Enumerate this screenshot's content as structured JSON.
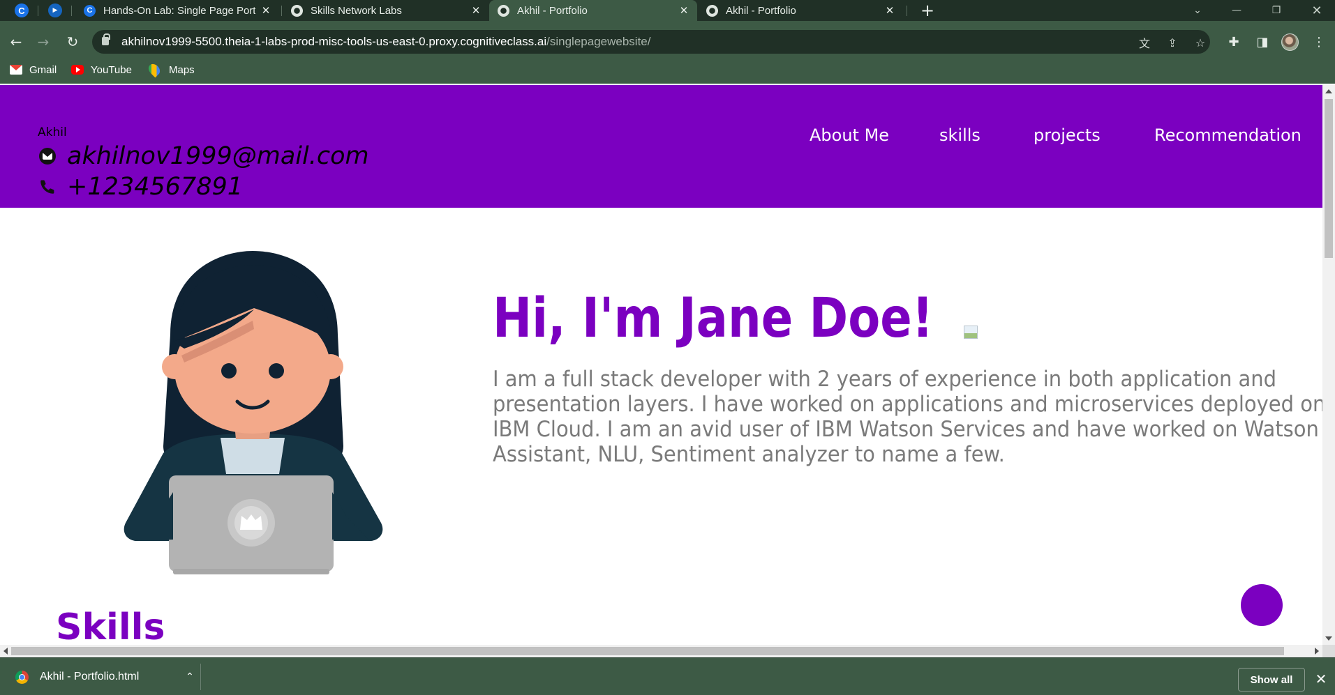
{
  "browser": {
    "tabs": [
      {
        "title": "Hands-On Lab: Single Page Portf",
        "icon": "c-icon",
        "active": false
      },
      {
        "title": "Skills Network Labs",
        "icon": "globe-icon",
        "active": false
      },
      {
        "title": "Akhil - Portfolio",
        "icon": "globe-icon",
        "active": true
      },
      {
        "title": "Akhil - Portfolio",
        "icon": "globe-icon",
        "active": false
      }
    ],
    "url_host": "akhilnov1999-5500.theia-1-labs-prod-misc-tools-us-east-0.proxy.cognitiveclass.ai",
    "url_path": "/singlepagewebsite/",
    "bookmarks": [
      {
        "label": "Gmail",
        "icon": "gmail-icon"
      },
      {
        "label": "YouTube",
        "icon": "youtube-icon"
      },
      {
        "label": "Maps",
        "icon": "maps-icon"
      }
    ],
    "colors": {
      "frame": "#203026",
      "toolbar": "#3d5a45"
    }
  },
  "site": {
    "header": {
      "name": "Akhil",
      "email": "akhilnov1999@mail.com",
      "phone": "+1234567891",
      "nav": [
        "About Me",
        "skills",
        "projects",
        "Recommendation"
      ],
      "background": "#7b00c0"
    },
    "hero": {
      "title": "Hi, I'm Jane Doe!",
      "lines": [
        "I am a full stack developer with 2 years of experience in both application and",
        "presentation layers. I have worked on applications and microservices deployed on",
        "IBM Cloud. I am an avid user of IBM Watson Services and have worked on Watson",
        "Assistant, NLU, Sentiment analyzer to name a few."
      ]
    },
    "skills_heading": "Skills",
    "accent": "#7b00c0"
  },
  "downloads": {
    "file": "Akhil - Portfolio.html",
    "show_all": "Show all"
  }
}
